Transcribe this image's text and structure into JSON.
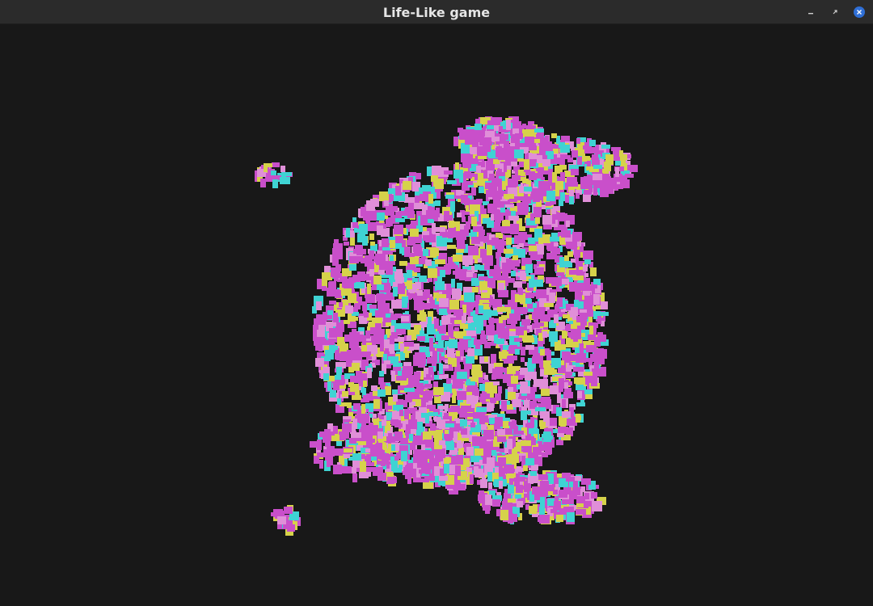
{
  "window": {
    "title": "Life-Like game"
  },
  "controls": {
    "minimize_icon": "minimize-icon",
    "maximize_icon": "maximize-icon",
    "close_icon": "close-icon"
  },
  "colors": {
    "background": "#181818",
    "titlebar": "#2b2b2b",
    "cell_magenta": "#c94fca",
    "cell_cyan": "#3fd3d3",
    "cell_yellow": "#d6d24a",
    "cell_pink": "#e08fd8",
    "close_button": "#2f6fd6"
  }
}
